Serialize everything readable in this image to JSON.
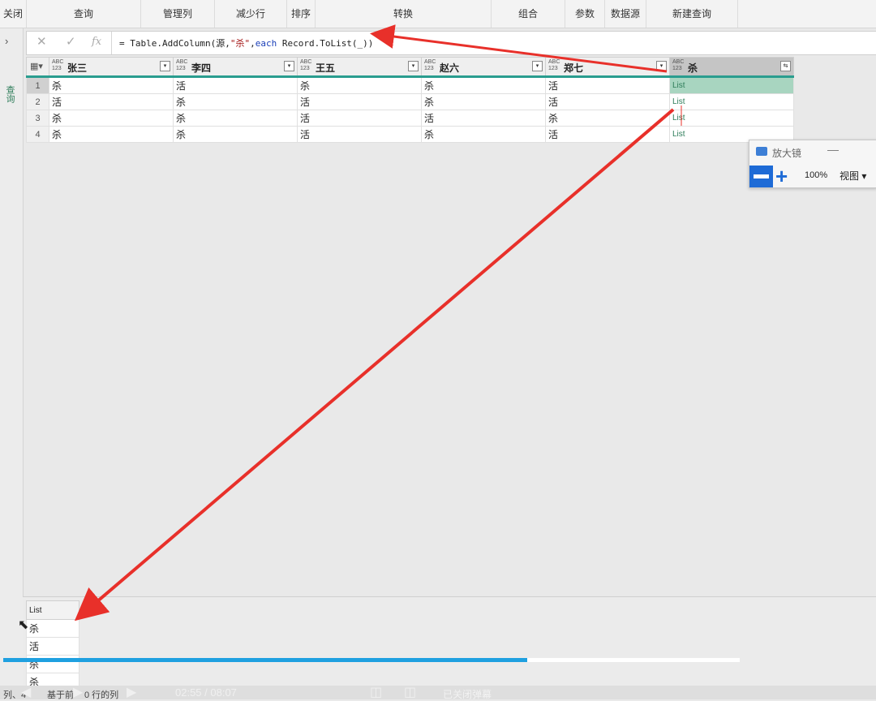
{
  "ribbon": [
    "关闭",
    "查询",
    "管理列",
    "减少行",
    "排序",
    "转换",
    "组合",
    "参数",
    "数据源",
    "新建查询"
  ],
  "leftbar": {
    "expand": "›",
    "label": "查询"
  },
  "formula_bar": {
    "cancel": "✕",
    "confirm": "✓",
    "fx": "fx",
    "formula_prefix": "= Table.AddColumn(源,",
    "formula_str": "\"杀\"",
    "formula_comma": ",",
    "formula_kw": "each",
    "formula_rest": " Record.ToList(_))"
  },
  "table": {
    "type_tag": "ABC 123",
    "columns": [
      "张三",
      "李四",
      "王五",
      "赵六",
      "郑七",
      "杀"
    ],
    "rows": [
      [
        "1",
        "杀",
        "活",
        "杀",
        "杀",
        "活",
        "List"
      ],
      [
        "2",
        "活",
        "杀",
        "活",
        "杀",
        "活",
        "List"
      ],
      [
        "3",
        "杀",
        "杀",
        "活",
        "活",
        "杀",
        "List"
      ],
      [
        "4",
        "杀",
        "杀",
        "活",
        "杀",
        "活",
        "List"
      ]
    ]
  },
  "magnifier": {
    "title": "放大镜",
    "minimize": "—",
    "zoom": "100%",
    "view": "视图 ▾"
  },
  "preview": {
    "header": "List",
    "values": [
      "杀",
      "活",
      "杀",
      "杀"
    ]
  },
  "status": {
    "left": "列、4",
    "mid": "基于前",
    "mid2": "0 行的列",
    "time": "02:55 / 08:07",
    "danmu": "已关闭弹幕"
  },
  "colors": {
    "accent": "#2a9d8f",
    "arrow": "#e8302a",
    "progress": "#1fa0e0"
  }
}
